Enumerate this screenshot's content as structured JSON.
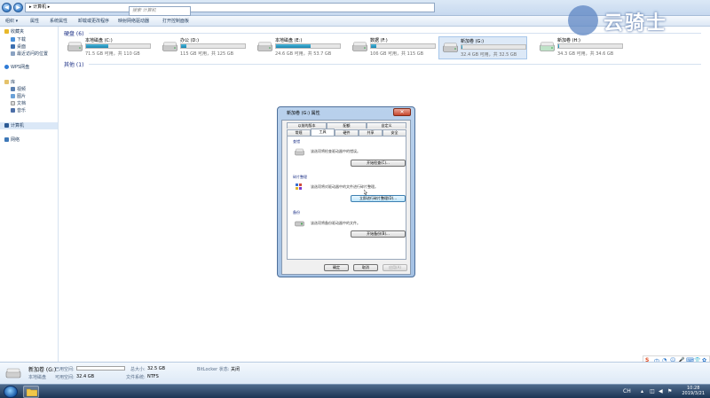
{
  "address": {
    "path": "▸ 计算机 ▸",
    "search_placeholder": "搜索 计算机"
  },
  "toolbar": {
    "items": [
      "组织 ▾",
      "属性",
      "系统属性",
      "卸载或更改程序",
      "映射网络驱动器",
      "打开控制面板"
    ]
  },
  "sidebar": {
    "favorites": "收藏夹",
    "downloads": "下载",
    "desktop": "桌面",
    "recent": "最近访问的位置",
    "wps": "WPS网盘",
    "libraries": "库",
    "videos": "视频",
    "pictures": "图片",
    "documents": "文档",
    "music": "音乐",
    "computer": "计算机",
    "network": "网络"
  },
  "groups": {
    "hdd": "硬盘 (6)",
    "other": "其他 (1)"
  },
  "drives": [
    {
      "name": "本地磁盘 (C:)",
      "cap": "71.5 GB 可用，共 110 GB",
      "used": 0.35
    },
    {
      "name": "办公 (D:)",
      "cap": "115 GB 可用，共 125 GB",
      "used": 0.08
    },
    {
      "name": "本地磁盘 (E:)",
      "cap": "24.6 GB 可用，共 53.7 GB",
      "used": 0.54
    },
    {
      "name": "数据 (F:)",
      "cap": "106 GB 可用，共 115 GB",
      "used": 0.08
    },
    {
      "name": "新加卷 (G:)",
      "cap": "32.4 GB 可用，共 32.5 GB",
      "used": 0.01
    },
    {
      "name": "新加卷 (H:)",
      "cap": "34.3 GB 可用，共 34.6 GB",
      "used": 0.01
    }
  ],
  "dialog": {
    "title": "新加卷 (G:) 属性",
    "close": "✕",
    "tabs_top": [
      "以前的版本",
      "配额",
      "自定义"
    ],
    "tabs_bottom": [
      "常规",
      "工具",
      "硬件",
      "共享",
      "安全"
    ],
    "check_title": "查错",
    "check_desc": "该选项将检查驱动器中的错误。",
    "check_btn": "开始检查(C)...",
    "defrag_title": "碎片整理",
    "defrag_desc": "该选项将对驱动器中的文件进行碎片整理。",
    "defrag_btn": "立即进行碎片整理(D)...",
    "backup_title": "备份",
    "backup_desc": "该选项将备份驱动器中的文件。",
    "backup_btn": "开始备份(B)...",
    "ok": "确定",
    "cancel": "取消",
    "apply": "应用(A)"
  },
  "details": {
    "name": "新加卷 (G:)",
    "type": "本地磁盘",
    "used_label": "已用空间:",
    "free_label": "可用空间:",
    "free_value": "32.4 GB",
    "total_label": "总大小:",
    "total_value": "32.5 GB",
    "fs_label": "文件系统:",
    "fs_value": "NTFS",
    "bitlocker_label": "BitLocker 状态:",
    "bitlocker_value": "关闭"
  },
  "ime": {
    "items": [
      "S",
      "中",
      "◔",
      "☺",
      "🎤",
      "⌨",
      "👕",
      "✿"
    ]
  },
  "tray": {
    "lang": "CH"
  },
  "clock": {
    "time": "10:28",
    "date": "2019/3/21"
  },
  "watermark": {
    "text": "云骑士"
  },
  "colors": {
    "accent": "#1a84ae",
    "title_blue": "#1e3287"
  }
}
